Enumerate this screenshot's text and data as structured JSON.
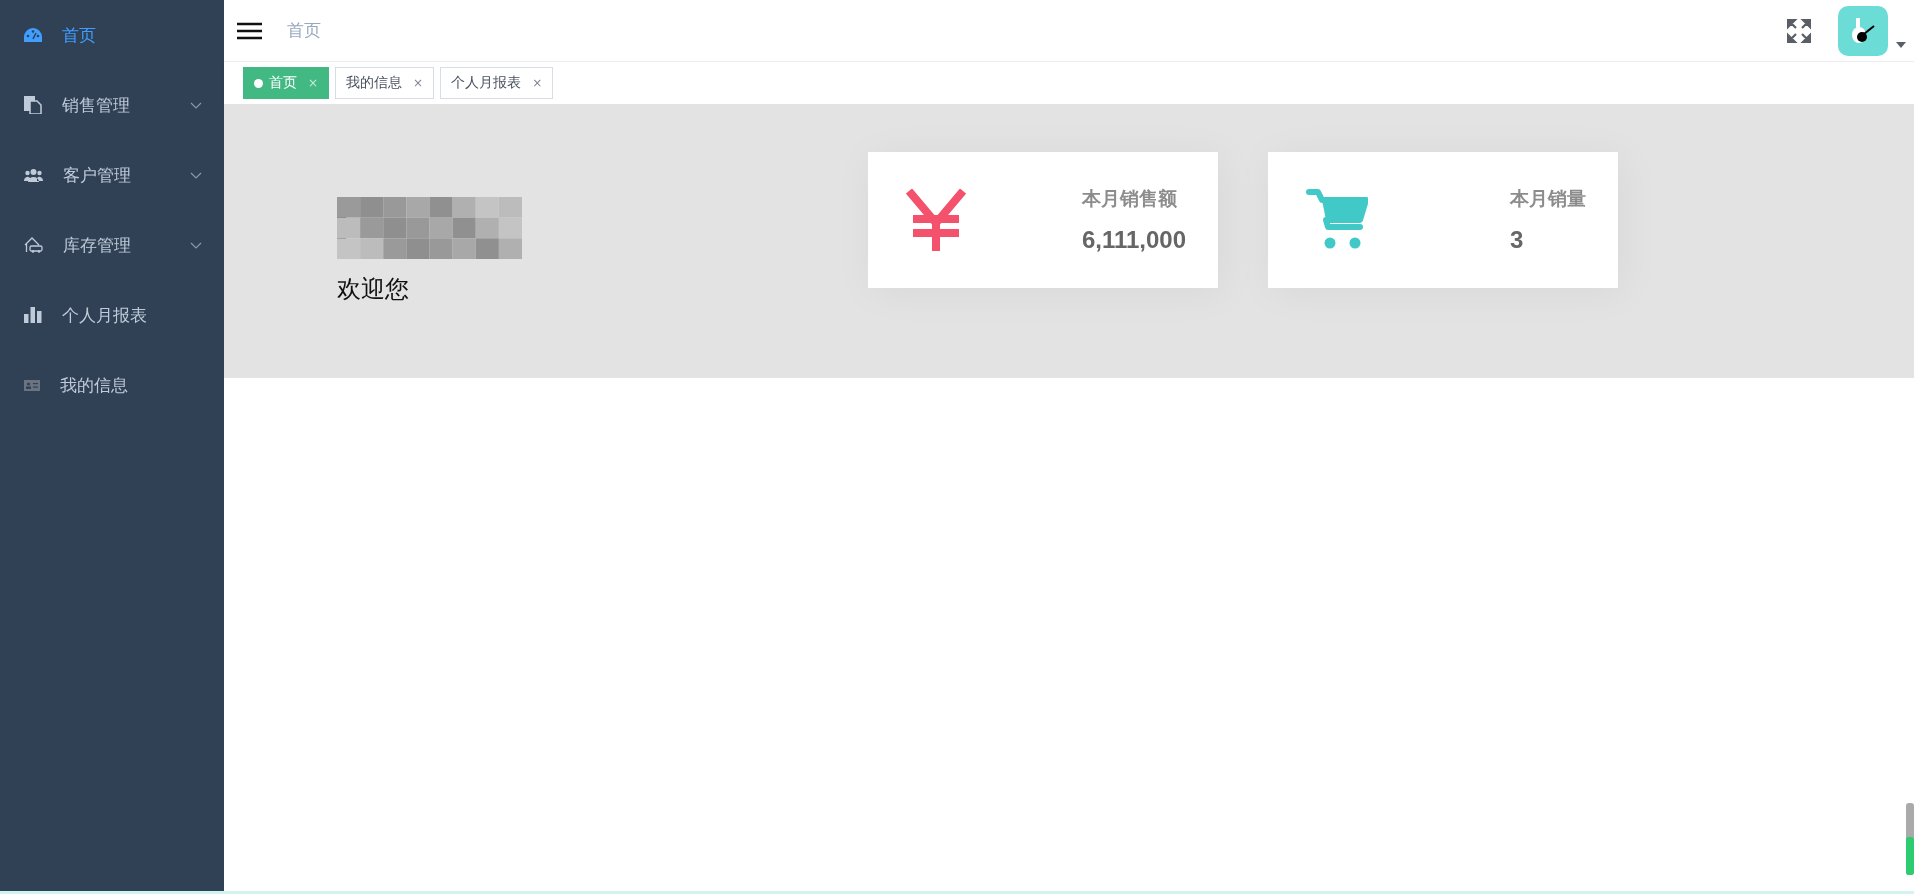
{
  "sidebar": {
    "items": [
      {
        "label": "首页",
        "kind": "dashboard",
        "selected": true,
        "expandable": false
      },
      {
        "label": "销售管理",
        "kind": "documents",
        "selected": false,
        "expandable": true
      },
      {
        "label": "客户管理",
        "kind": "people",
        "selected": false,
        "expandable": true
      },
      {
        "label": "库存管理",
        "kind": "garage",
        "selected": false,
        "expandable": true
      },
      {
        "label": "个人月报表",
        "kind": "bars",
        "selected": false,
        "expandable": false
      },
      {
        "label": "我的信息",
        "kind": "idcard",
        "selected": false,
        "expandable": false
      }
    ]
  },
  "header": {
    "breadcrumb": "首页"
  },
  "tabs": [
    {
      "label": "首页",
      "selected": true,
      "close": "×"
    },
    {
      "label": "我的信息",
      "selected": false,
      "close": "×"
    },
    {
      "label": "个人月报表",
      "selected": false,
      "close": "×"
    }
  ],
  "welcome": {
    "greeting": "欢迎您"
  },
  "cards": [
    {
      "kind": "money",
      "color": "#f4516c",
      "label": "本月销售额",
      "value": "6,111,000"
    },
    {
      "kind": "cart",
      "color": "#40c9c6",
      "label": "本月销量",
      "value": "3"
    }
  ]
}
